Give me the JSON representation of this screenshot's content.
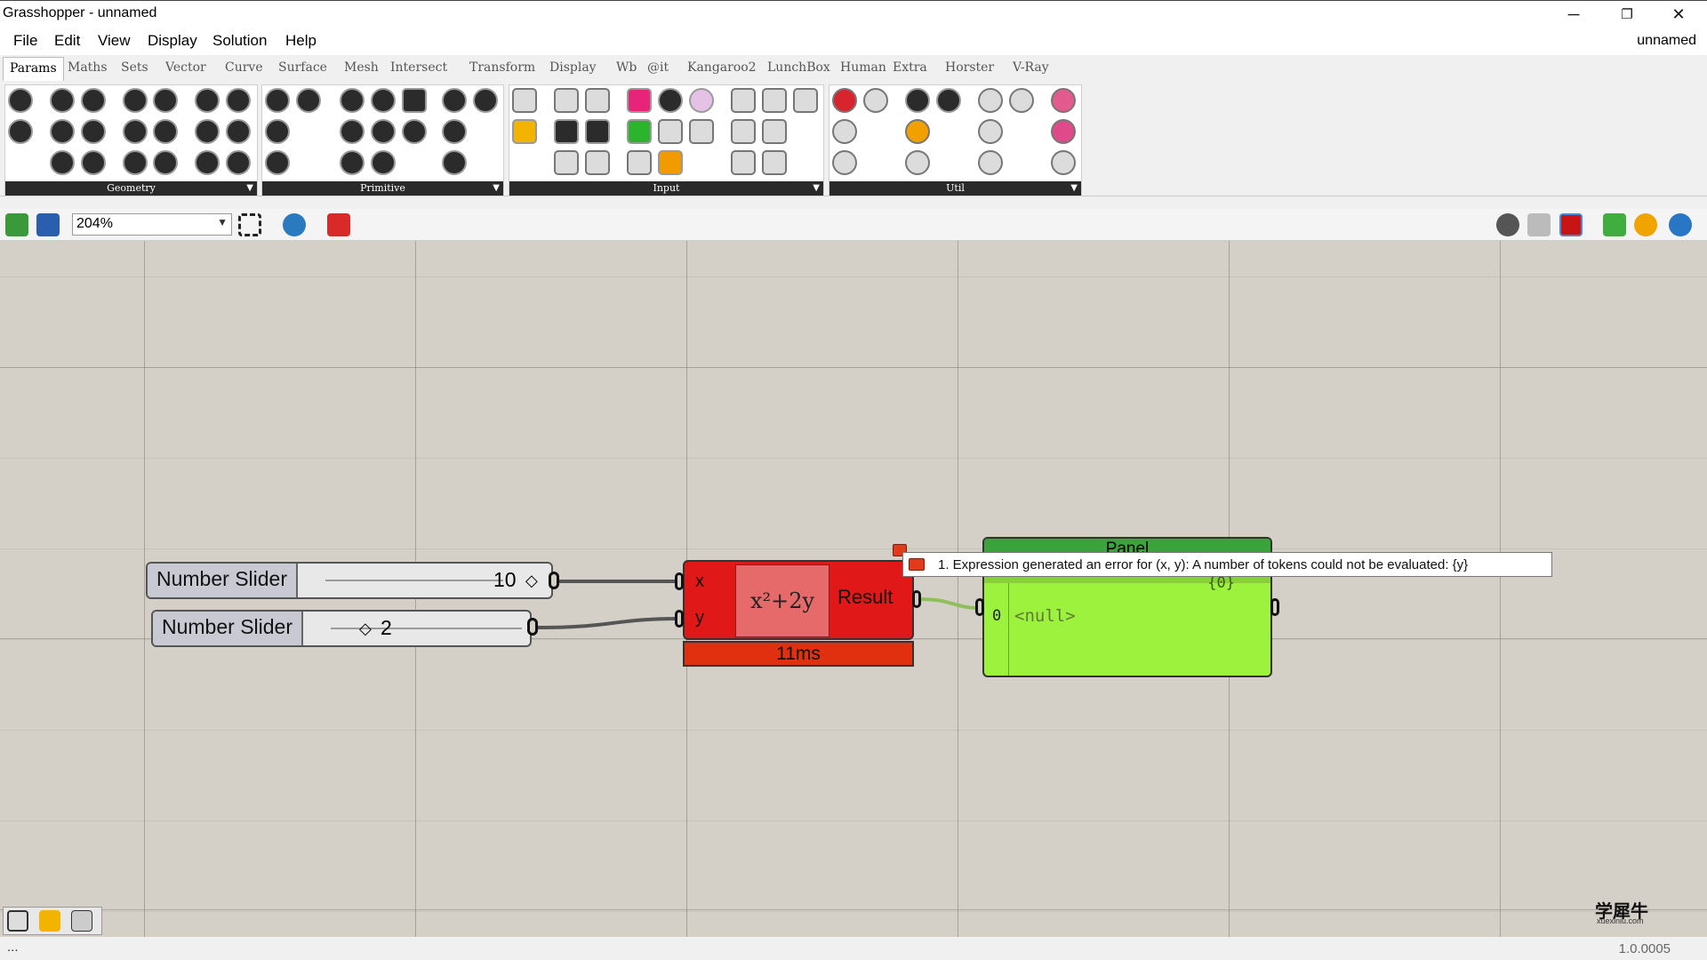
{
  "window": {
    "title": "Grasshopper - unnamed",
    "minimize": "─",
    "restore": "❐",
    "close": "✕"
  },
  "menu": {
    "items": [
      "File",
      "Edit",
      "View",
      "Display",
      "Solution",
      "Help"
    ],
    "document_name": "unnamed"
  },
  "tabs": [
    "Params",
    "Maths",
    "Sets",
    "Vector",
    "Curve",
    "Surface",
    "Mesh",
    "Intersect",
    "Transform",
    "Display",
    "Wb",
    "@it",
    "Kangaroo2",
    "LunchBox",
    "Human",
    "Extra",
    "Horster",
    "V-Ray"
  ],
  "ribbon_groups": [
    "Geometry",
    "Primitive",
    "Input",
    "Util"
  ],
  "canvas_toolbar": {
    "zoom": "204%"
  },
  "components": {
    "slider1": {
      "label": "Number Slider",
      "value": "10"
    },
    "slider2": {
      "label": "Number Slider",
      "value": "2"
    },
    "expression": {
      "input_x": "x",
      "input_y": "y",
      "formula": "x²+2y",
      "output": "Result",
      "timer": "11ms"
    },
    "panel": {
      "title": "Panel",
      "path": "{0}",
      "index": "0",
      "value": "<null>"
    }
  },
  "tooltip": {
    "message": "1. Expression generated an error for (x, y): A number of tokens could not be evaluated: {y}"
  },
  "status": {
    "left": "...",
    "version": "1.0.0005"
  },
  "watermark": {
    "text": "学犀牛",
    "url": "xuexiniu.com"
  },
  "colors": {
    "expression_body": "#e01818",
    "panel_body": "#9cf23c",
    "canvas": "#d4d0c8"
  }
}
